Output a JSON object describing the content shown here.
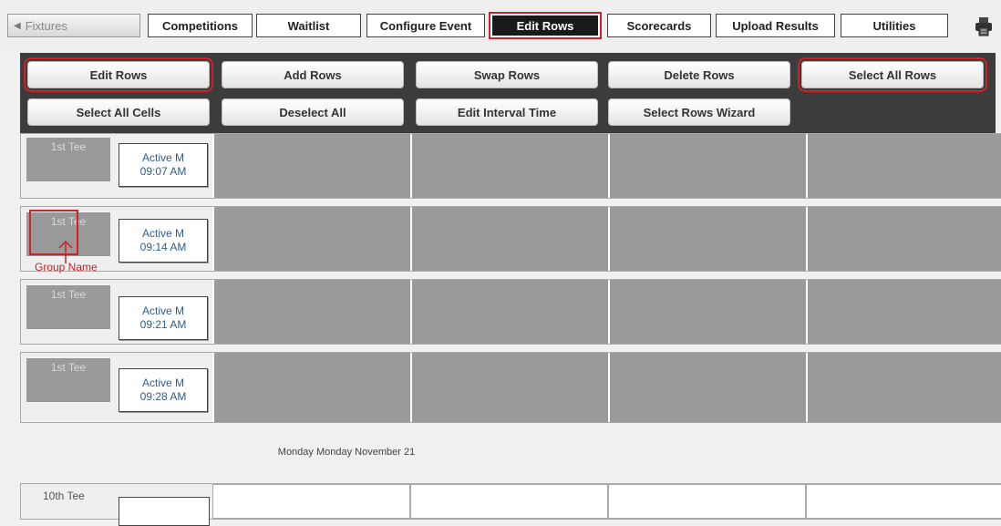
{
  "top_tabs": {
    "fixtures": "Fixtures",
    "competitions": "Competitions",
    "waitlist": "Waitlist",
    "configure_event": "Configure Event",
    "edit_rows": "Edit Rows",
    "scorecards": "Scorecards",
    "upload_results": "Upload Results",
    "utilities": "Utilities"
  },
  "actions": {
    "edit_rows": "Edit Rows",
    "add_rows": "Add Rows",
    "swap_rows": "Swap Rows",
    "delete_rows": "Delete Rows",
    "select_all_rows": "Select All Rows",
    "select_all_cells": "Select All Cells",
    "deselect_all": "Deselect All",
    "edit_interval_time": "Edit Interval Time",
    "select_rows_wizard": "Select Rows Wizard"
  },
  "rows": [
    {
      "tee": "1st Tee",
      "status": "Active M",
      "time": "09:07 AM"
    },
    {
      "tee": "1st Tee",
      "status": "Active M",
      "time": "09:14 AM"
    },
    {
      "tee": "1st Tee",
      "status": "Active M",
      "time": "09:21 AM"
    },
    {
      "tee": "1st Tee",
      "status": "Active M",
      "time": "09:28 AM"
    }
  ],
  "annotation": {
    "group_name": "Group Name"
  },
  "date_separator": "Monday Monday November 21",
  "next_section": {
    "tee": "10th Tee"
  },
  "colors": {
    "highlight": "#d0202a",
    "panel": "#3c3c3c",
    "occupied_cell": "#9a9a9a",
    "link_text": "#2d5d8f"
  }
}
